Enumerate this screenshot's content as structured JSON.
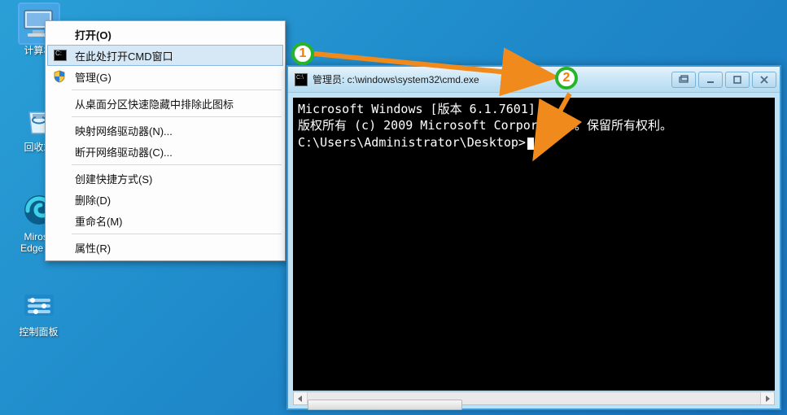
{
  "desktop": {
    "icons": [
      {
        "label": "计算机",
        "name": "desktop-icon-computer"
      },
      {
        "label": "回收站",
        "name": "desktop-icon-recycle-bin"
      },
      {
        "label": "Mirosft\nEdge 87",
        "name": "desktop-icon-edge"
      },
      {
        "label": "控制面板",
        "name": "desktop-icon-control-panel"
      }
    ]
  },
  "context_menu": {
    "items": [
      {
        "label": "打开(O)",
        "bold": true,
        "sep_after": false
      },
      {
        "label": "在此处打开CMD窗口",
        "icon": "cmd-icon",
        "hover": true,
        "sep_after": false
      },
      {
        "label": "管理(G)",
        "icon": "shield-icon",
        "sep_after": true
      },
      {
        "label": "从桌面分区快速隐藏中排除此图标",
        "sep_after": true
      },
      {
        "label": "映射网络驱动器(N)...",
        "sep_after": false
      },
      {
        "label": "断开网络驱动器(C)...",
        "sep_after": true
      },
      {
        "label": "创建快捷方式(S)",
        "sep_after": false
      },
      {
        "label": "删除(D)",
        "sep_after": false
      },
      {
        "label": "重命名(M)",
        "sep_after": true
      },
      {
        "label": "属性(R)",
        "sep_after": false
      }
    ]
  },
  "cmd_window": {
    "title": "管理员: c:\\windows\\system32\\cmd.exe",
    "lines": [
      "Microsoft Windows [版本 6.1.7601]",
      "版权所有 (c) 2009 Microsoft Corporation。保留所有权利。",
      "",
      "C:\\Users\\Administrator\\Desktop>"
    ]
  },
  "annotations": {
    "badge1": "1",
    "badge2": "2"
  }
}
